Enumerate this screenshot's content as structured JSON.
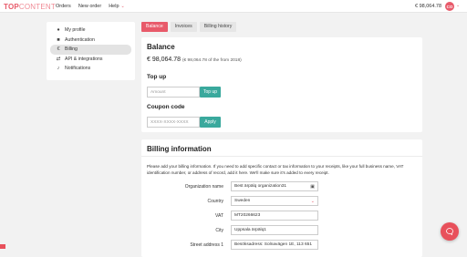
{
  "header": {
    "logo_part1": "TOP",
    "logo_part2": "CONTENT",
    "nav": [
      "Orders",
      "New order",
      "Help"
    ],
    "balance": "€ 98,064.78",
    "avatar_initials": "CO"
  },
  "sidebar": {
    "items": [
      {
        "label": "My profile",
        "icon": "person-icon"
      },
      {
        "label": "Authentication",
        "icon": "lock-icon"
      },
      {
        "label": "Billing",
        "icon": "euro-icon",
        "active": true
      },
      {
        "label": "API & integrations",
        "icon": "exchange-icon"
      },
      {
        "label": "Notifications",
        "icon": "bell-icon"
      }
    ]
  },
  "tabs": [
    "Balance",
    "Invoices",
    "Billing history"
  ],
  "balance_card": {
    "title": "Balance",
    "amount": "€ 98,064.78",
    "amount_note": "(€ 98,064.78 of the from 2018)",
    "topup_title": "Top up",
    "topup_placeholder": "Amount",
    "topup_button": "Top up",
    "coupon_title": "Coupon code",
    "coupon_placeholder": "XXXX-XXXX-XXXX",
    "coupon_button": "Apply"
  },
  "billing_card": {
    "title": "Billing information",
    "description": "Please add your billing information. If you need to add specific contact or tax information to your receipts, like your full business name, VAT identification number, or address of record, add it here. We'll make sure it's added to every receipt.",
    "fields": [
      {
        "label": "Organization name",
        "value": "Best ärpälq organization31"
      },
      {
        "label": "Country",
        "value": "Sweden"
      },
      {
        "label": "VAT",
        "value": "MT20266623"
      },
      {
        "label": "City",
        "value": "Uppsala ärpälq1"
      },
      {
        "label": "Street address 1",
        "value": "Besöksadress: Solnavägen 1E, 113 651"
      }
    ]
  },
  "colors": {
    "brand": "#e85a6a",
    "teal": "#3aa99d"
  }
}
